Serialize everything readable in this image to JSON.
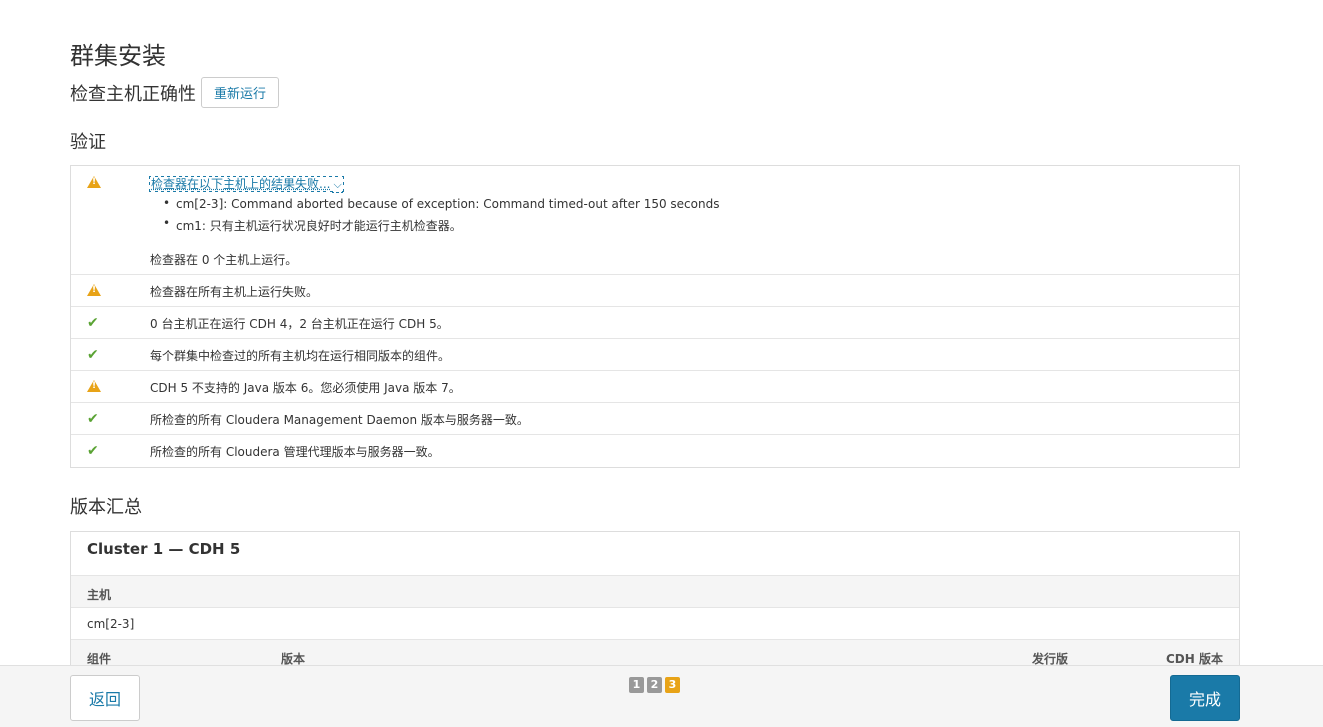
{
  "page": {
    "title": "群集安装",
    "subtitle": "检查主机正确性",
    "rerun_label": "重新运行"
  },
  "validation": {
    "title": "验证",
    "rows": [
      {
        "status": "warning",
        "link_text": "检查器在以下主机上的结果失败...",
        "errors": [
          "cm[2-3]: Command aborted because of exception: Command timed-out after 150 seconds",
          "cm1: 只有主机运行状况良好时才能运行主机检查器。"
        ],
        "footer_text": "检查器在 0 个主机上运行。"
      },
      {
        "status": "warning",
        "text": "检查器在所有主机上运行失败。"
      },
      {
        "status": "ok",
        "text": "0 台主机正在运行 CDH 4，2 台主机正在运行 CDH 5。"
      },
      {
        "status": "ok",
        "text": "每个群集中检查过的所有主机均在运行相同版本的组件。"
      },
      {
        "status": "warning",
        "text": "CDH 5 不支持的 Java 版本 6。您必须使用 Java 版本 7。"
      },
      {
        "status": "ok",
        "text": "所检查的所有 Cloudera Management Daemon 版本与服务器一致。"
      },
      {
        "status": "ok",
        "text": "所检查的所有 Cloudera 管理代理版本与服务器一致。"
      }
    ]
  },
  "version_summary": {
    "title": "版本汇总",
    "cluster_name": "Cluster 1 — CDH 5",
    "hosts_header": "主机",
    "hosts_value": "cm[2-3]",
    "columns": [
      "组件",
      "版本",
      "发行版",
      "CDH 版本"
    ]
  },
  "footer": {
    "back_label": "返回",
    "done_label": "完成",
    "steps": [
      "1",
      "2",
      "3"
    ],
    "active_step": "3"
  },
  "colors": {
    "accent": "#1a7aa8",
    "warning": "#e8a317",
    "ok": "#5aa334"
  }
}
